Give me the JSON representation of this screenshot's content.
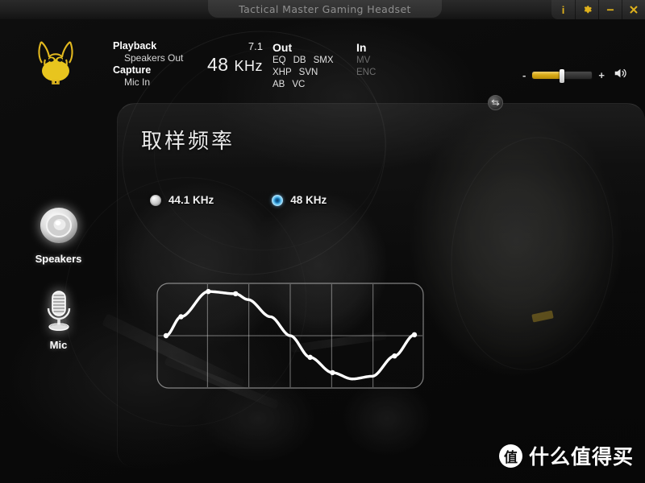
{
  "window": {
    "title": "Tactical Master Gaming Headset",
    "buttons": [
      {
        "name": "info",
        "label": "i",
        "icon": "info-icon"
      },
      {
        "name": "settings",
        "label": "",
        "icon": "gear-icon"
      },
      {
        "name": "minimize",
        "label": "",
        "icon": "minimize-icon"
      },
      {
        "name": "close",
        "label": "",
        "icon": "close-icon"
      }
    ],
    "accent_gold": "#e0b21c"
  },
  "header": {
    "logo_name": "wolf-head-logo",
    "playback": {
      "label": "Playback",
      "value": "Speakers Out"
    },
    "capture": {
      "label": "Capture",
      "value": "Mic In"
    },
    "channels": "7.1",
    "sample_rate_value": "48",
    "sample_rate_unit": "KHz",
    "out": {
      "title": "Out",
      "rows": [
        [
          "EQ",
          "DB",
          "SMX"
        ],
        [
          "XHP",
          "SVN"
        ],
        [
          "AB",
          "VC"
        ]
      ]
    },
    "in": {
      "title": "In",
      "rows": [
        [
          "MV"
        ],
        [
          "ENC"
        ]
      ]
    },
    "swap_button_icon": "left-right-arrow-icon",
    "volume": {
      "minus": "-",
      "plus": "+",
      "level_percent": 50,
      "speaker_icon": "speaker-volume-icon",
      "fill_color": "#d9ab18"
    }
  },
  "sidebar": {
    "items": [
      {
        "label": "Speakers",
        "icon": "speaker-device-icon",
        "selected": false
      },
      {
        "label": "Mic",
        "icon": "microphone-icon",
        "selected": true
      }
    ]
  },
  "panel": {
    "title": "取样频率",
    "options": [
      {
        "label": "44.1 KHz",
        "selected": false
      },
      {
        "label": "48 KHz",
        "selected": true
      }
    ],
    "selected_color": "#61c3f2"
  },
  "chart_data": {
    "type": "line",
    "title": "",
    "xlabel": "",
    "ylabel": "",
    "grid": true,
    "legend": false,
    "xlim": [
      0,
      1
    ],
    "ylim": [
      -1,
      1
    ],
    "x_gridlines": [
      0.1667,
      0.3333,
      0.5,
      0.6667,
      0.8333
    ],
    "y_gridlines": [
      0
    ],
    "series": [
      {
        "name": "sample-waveform",
        "x": [
          0.0,
          0.06,
          0.17,
          0.28,
          0.33,
          0.42,
          0.5,
          0.58,
          0.67,
          0.75,
          0.83,
          0.92,
          1.0
        ],
        "y": [
          0.0,
          0.42,
          0.98,
          0.93,
          0.8,
          0.42,
          0.0,
          -0.48,
          -0.82,
          -0.96,
          -0.9,
          -0.45,
          0.02
        ],
        "color": "#ffffff",
        "marker": "circle",
        "marker_points_x": [
          0.0,
          0.06,
          0.17,
          0.28,
          0.58,
          0.67,
          0.92,
          1.0
        ],
        "marker_points_y": [
          0.0,
          0.42,
          0.98,
          0.93,
          -0.48,
          -0.82,
          -0.45,
          0.02
        ]
      }
    ]
  },
  "watermark": {
    "mark": "值",
    "text": "什么值得买"
  }
}
